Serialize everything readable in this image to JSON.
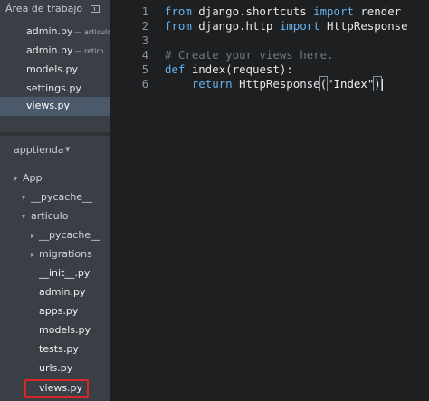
{
  "sidebar": {
    "working_files": {
      "title": "Área de trabajo",
      "items": [
        {
          "name": "admin.py",
          "sub": "— articulo"
        },
        {
          "name": "admin.py",
          "sub": "— retiro"
        },
        {
          "name": "models.py",
          "sub": ""
        },
        {
          "name": "settings.py",
          "sub": ""
        },
        {
          "name": "views.py",
          "sub": ""
        }
      ]
    },
    "project": {
      "name": "apptienda",
      "tree": [
        {
          "label": "App",
          "expanded": true
        },
        {
          "label": "__pycache__",
          "expanded": true
        },
        {
          "label": "articulo",
          "expanded": true
        },
        {
          "label": "__pycache__",
          "expanded": false
        },
        {
          "label": "migrations",
          "expanded": false
        },
        {
          "label": "__init__.py"
        },
        {
          "label": "admin.py"
        },
        {
          "label": "apps.py"
        },
        {
          "label": "models.py"
        },
        {
          "label": "tests.py"
        },
        {
          "label": "urls.py"
        },
        {
          "label": "views.py"
        }
      ]
    }
  },
  "editor": {
    "line_numbers": [
      "1",
      "2",
      "3",
      "4",
      "5",
      "6"
    ],
    "line1": {
      "kw1": "from",
      "mod": " django.shortcuts ",
      "kw2": "import",
      "name": " render"
    },
    "line2": {
      "kw1": "from",
      "mod": " django.http ",
      "kw2": "import",
      "name": " HttpResponse"
    },
    "line4": {
      "comment": "# Create your views here."
    },
    "line5": {
      "kw": "def",
      "fn": " index",
      "rest": "(request):"
    },
    "line6": {
      "indent": "    ",
      "kw": "return",
      "call": " HttpResponse",
      "open": "(",
      "str": "\"Index\"",
      "close": ")"
    }
  },
  "colors": {
    "keyword": "#66b3f0",
    "highlight_box": "#d8262a",
    "selected_file": "#4a5a6b"
  }
}
